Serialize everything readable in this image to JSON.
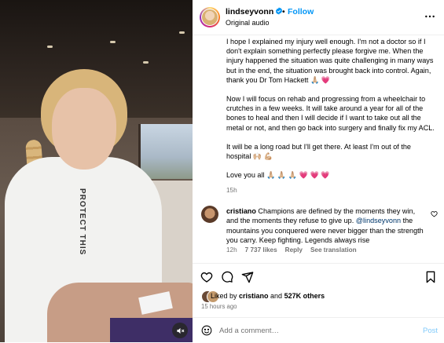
{
  "video": {
    "hoodie_text": "PROTECT THIS",
    "mute_icon": "speaker-muted-icon"
  },
  "header": {
    "username": "lindseyvonn",
    "dot": "•",
    "follow_label": "Follow",
    "audio_label": "Original audio",
    "more_icon": "more-horizontal-icon"
  },
  "caption": {
    "paragraphs": [
      "I hope I explained my injury well enough. I'm not a doctor so if I don't explain something perfectly please forgive me. When the injury happened the situation was quite challenging in many ways but in the end, the situation was brought back into control. Again, thank you Dr Tom Hackett 🙏🏼 💗",
      "Now I will focus on rehab and progressing from a wheelchair to crutches in a few weeks. It will take around a year for all of the bones to heal and then I will decide if I want to take out all the metal or not, and then go back into surgery and finally fix my ACL.",
      "It will be a long road but I'll get there. At least I'm out of the hospital 🙌🏼 💪🏼",
      "Love you all 🙏🏼 🙏🏼 🙏🏼 💗 💗 💗"
    ],
    "time": "15h"
  },
  "comment": {
    "username": "cristiano",
    "text_before": " Champions are defined by the moments they win, and the moments they refuse to give up. ",
    "mention": "@lindseyvonn",
    "text_after": " the mountains you conquered were never bigger than the strength you carry. Keep fighting. Legends always rise",
    "time": "12h",
    "likes": "7 737 likes",
    "reply": "Reply",
    "translation": "See translation"
  },
  "likes": {
    "prefix": "Liked by ",
    "user": "cristiano",
    "and": " and ",
    "others": "527K others",
    "ago": "15 hours ago"
  },
  "add_comment": {
    "placeholder": "Add a comment…",
    "post_label": "Post"
  },
  "colors": {
    "accent": "#0095f6",
    "muted": "#737373",
    "mention": "#00376b"
  }
}
